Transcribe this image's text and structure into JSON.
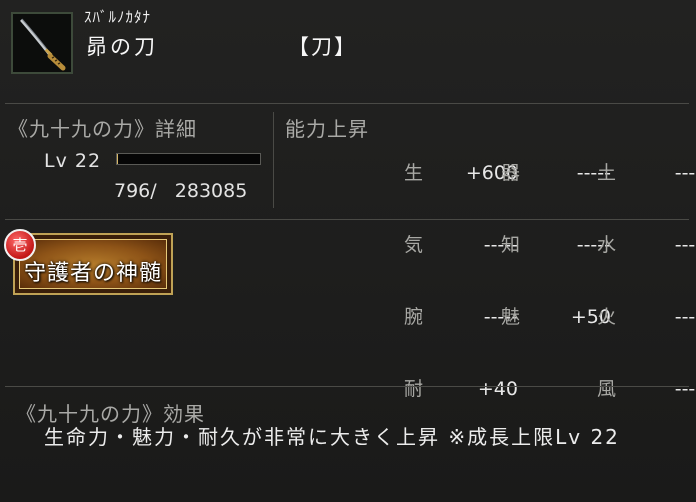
{
  "item": {
    "kana": "ｽﾊﾞﾙﾉｶﾀﾅ",
    "name": "昴の刀",
    "type": "【刀】",
    "icon": "katana-icon"
  },
  "growth": {
    "title": "《九十九の力》詳細",
    "level_label": "Lv 22",
    "exp_current": "796/",
    "exp_next": "283085",
    "exp_fraction": 0.0028
  },
  "stats": {
    "title": "能力上昇",
    "col1": [
      {
        "key": "生",
        "value": "+600"
      },
      {
        "key": "気",
        "value": "-----"
      },
      {
        "key": "腕",
        "value": "-----"
      },
      {
        "key": "耐",
        "value": "+40"
      }
    ],
    "col2": [
      {
        "key": "器",
        "value": "-----"
      },
      {
        "key": "知",
        "value": "-----"
      },
      {
        "key": "魅",
        "value": "+50"
      }
    ],
    "col3": [
      {
        "key": "土",
        "value": "-----"
      },
      {
        "key": "水",
        "value": "-----"
      },
      {
        "key": "火",
        "value": "-----"
      },
      {
        "key": "風",
        "value": "-----"
      }
    ]
  },
  "skill": {
    "rank": "壱",
    "label": "守護者の神髄"
  },
  "effect": {
    "title": "《九十九の力》効果",
    "text": "生命力・魅力・耐久が非常に大きく上昇 ※成長上限Lv 22"
  },
  "colors": {
    "background": "#1c1c1b",
    "label_gray": "#a9a9a6",
    "exp_fill": "#d8b868",
    "skill_gold": "#bfa255",
    "badge_red": "#c31717"
  }
}
